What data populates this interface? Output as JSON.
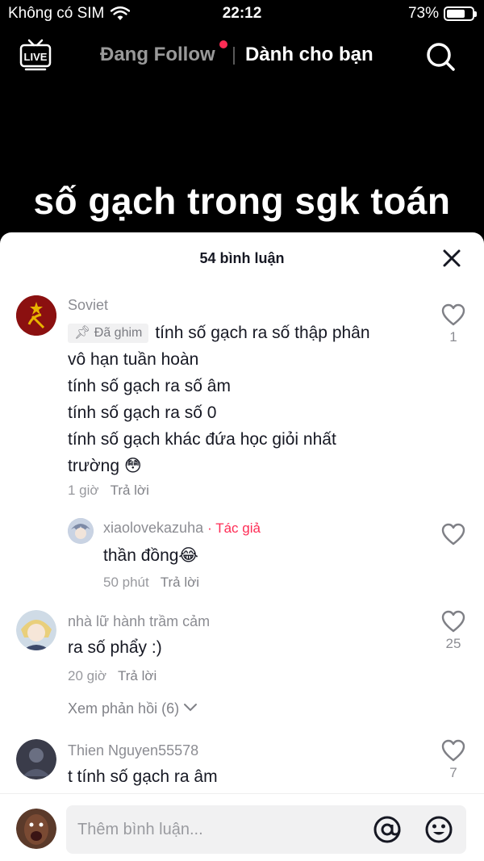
{
  "status_bar": {
    "carrier": "Không có SIM",
    "time": "22:12",
    "battery": "73%",
    "battery_level": 0.73
  },
  "nav": {
    "tab_following": "Đang Follow",
    "tab_for_you": "Dành cho bạn"
  },
  "video": {
    "caption": "số gạch trong sgk toán"
  },
  "comments_panel": {
    "title": "54 bình luận",
    "comments": [
      {
        "username": "Soviet",
        "pinned_label": "Đã ghim",
        "text_lines": [
          "tính số gạch ra số thập phân",
          "vô hạn tuần hoàn",
          "tính số gạch ra số âm",
          "tính số gạch ra số 0",
          "tính số gạch khác đứa học giỏi nhất",
          "trường 😳"
        ],
        "time": "1 giờ",
        "reply_label": "Trả lời",
        "likes": "1"
      },
      {
        "username": "xiaolovekazuha",
        "author_tag": "Tác giả",
        "text": "thần đồng😂",
        "time": "50 phút",
        "reply_label": "Trả lời"
      },
      {
        "username": "nhà lữ hành trầm cảm",
        "text": "ra số phẩy :)",
        "time": "20 giờ",
        "reply_label": "Trả lời",
        "likes": "25",
        "view_replies": "Xem phản hồi (6)"
      },
      {
        "username": "Thien Nguyen55578",
        "text": "t tính số gạch ra âm",
        "likes": "7"
      }
    ]
  },
  "input": {
    "placeholder": "Thêm bình luận..."
  },
  "colors": {
    "accent": "#fe2c55",
    "sheet_bg": "#ffffff",
    "text_primary": "#161823"
  }
}
